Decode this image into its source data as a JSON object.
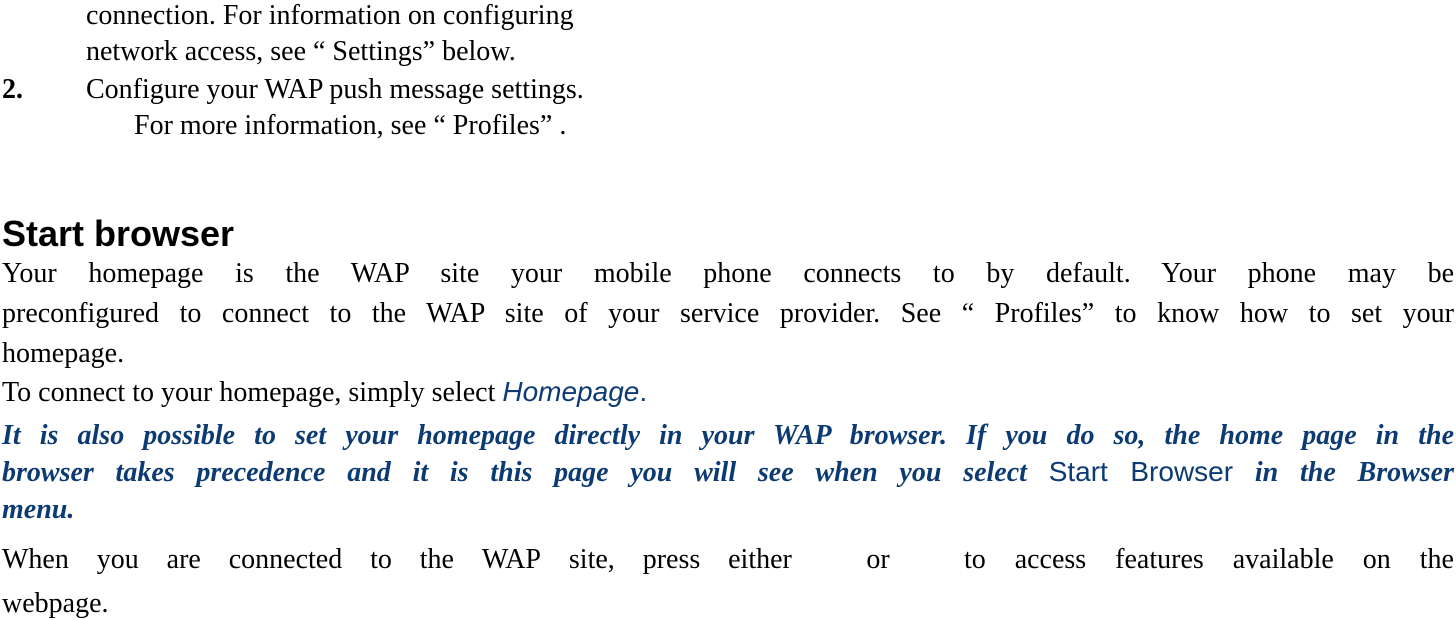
{
  "list": {
    "item1_cont_line1": "connection. For information on configuring",
    "item1_cont_line2": "network access, see “ Settings”    below.",
    "item2_number": "2.",
    "item2_line1": "Configure your WAP push message settings.",
    "item2_line2": "For more information, see “ Profiles” ."
  },
  "section": {
    "title": "Start browser",
    "para1_line1": "Your homepage is the WAP site your mobile phone connects to by default. Your phone may be",
    "para1_line2": "preconfigured to connect to the WAP site of your service provider. See “ Profiles” to know how to set your",
    "para1_line3": "homepage.",
    "para2_text": "To connect to your homepage, simply select ",
    "para2_ui": "Homepage",
    "para2_end": ".",
    "note_line1": "It is also possible to set your homepage directly in your WAP browser. If you do so, the home page in the",
    "note_line2_a": "browser takes precedence and it is this page you will see when you select ",
    "note_line2_ui": "Start Browser",
    "note_line2_b": " in the Browser",
    "note_line3": "menu.",
    "para3_line1_a": "When you are connected to the WAP site, press either",
    "para3_line1_or": "or",
    "para3_line1_b": "to access features available on the",
    "para3_line2": "webpage."
  },
  "colors": {
    "text": "#000000",
    "accent": "#0c3a73"
  }
}
